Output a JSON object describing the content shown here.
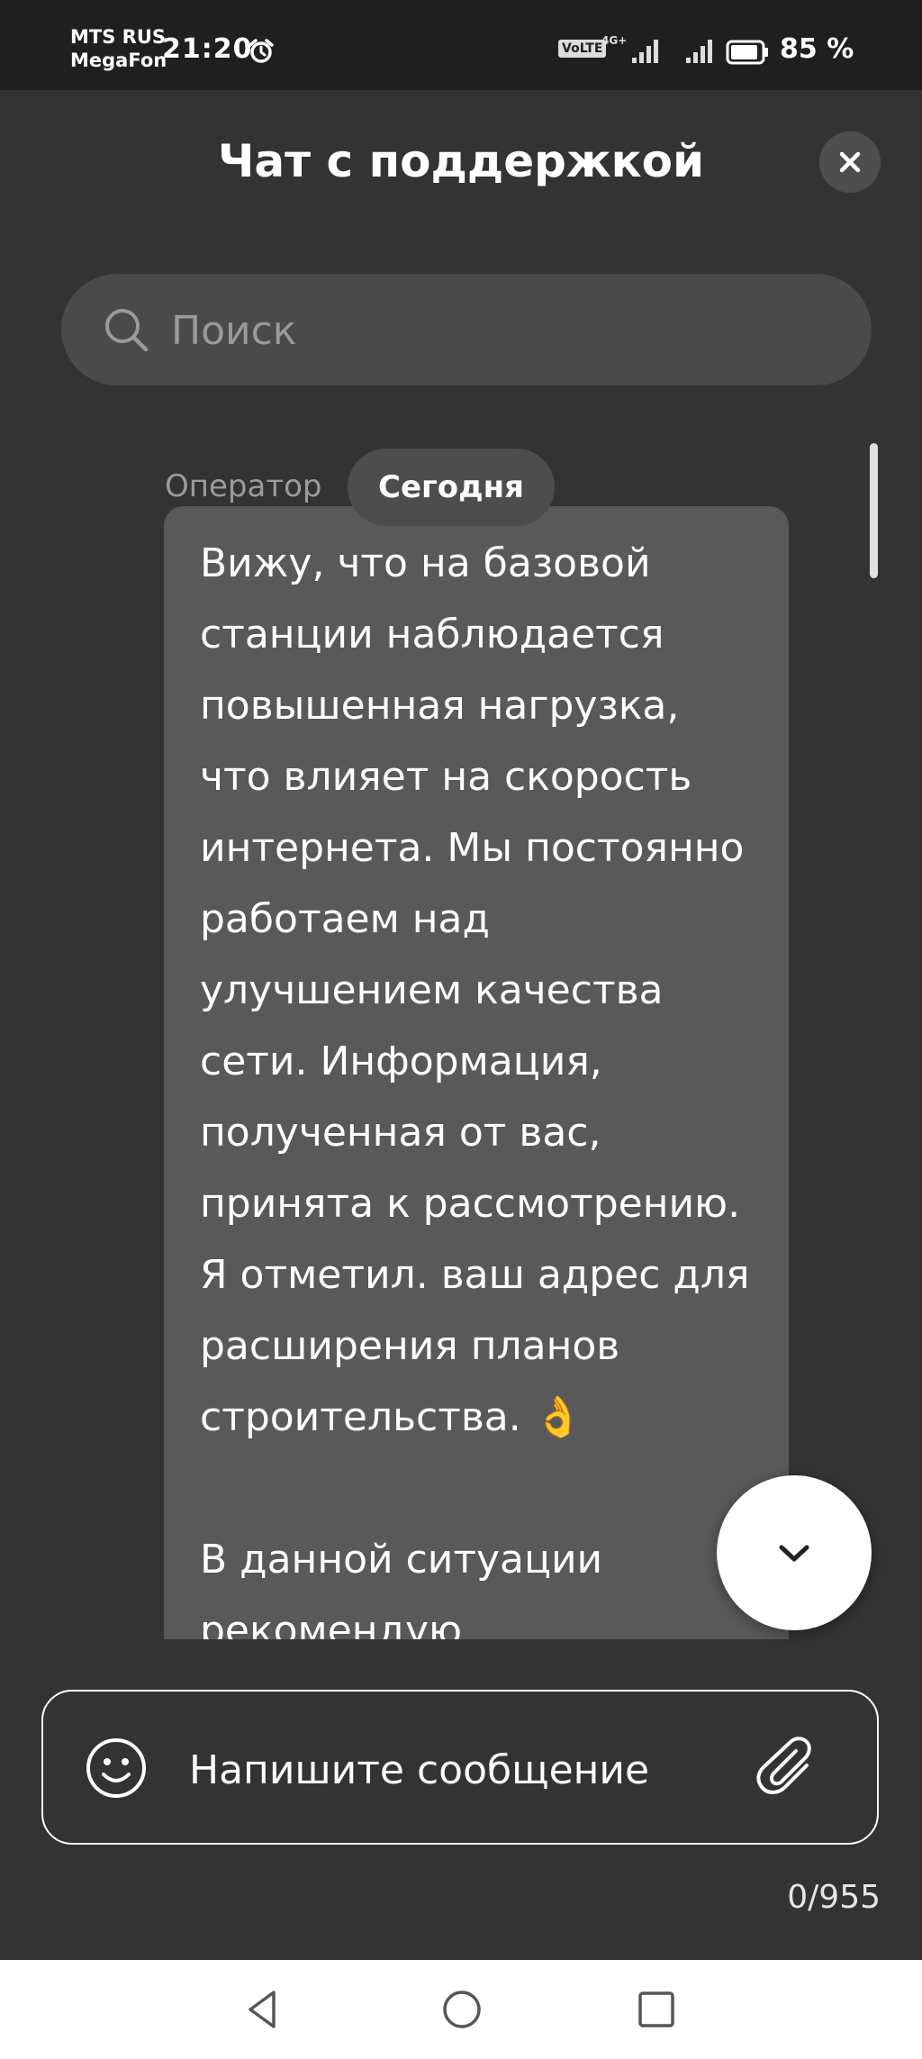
{
  "status_bar": {
    "carrier_line1": "MTS RUS",
    "carrier_line2": "MegaFon",
    "time": "21:20",
    "volte": "VoLTE",
    "network": "4G+",
    "battery": "85 %"
  },
  "header": {
    "title": "Чат с поддержкой"
  },
  "search": {
    "placeholder": "Поиск"
  },
  "chat": {
    "date_chip": "Сегодня",
    "message": {
      "sender": "Оператор",
      "text": "Вижу, что на базовой\nстанции наблюдается\nповышенная нагрузка,\nчто влияет на скорость\nинтернета. Мы постоянно\nработаем над\nулучшением качества\nсети. Информация,\nполученная от вас,\nпринята к рассмотрению.\nЯ отметил. ваш адрес для\nрасширения планов\nстроительства. 👌\n\nВ данной ситуации\nрекомендую"
    }
  },
  "composer": {
    "placeholder": "Напишите сообщение",
    "counter": "0/955"
  },
  "icons": {
    "alarm": "alarm-icon",
    "close": "close-icon",
    "search": "search-icon",
    "scroll_down": "chevron-down-icon",
    "emoji": "smiley-icon",
    "attach": "paperclip-icon",
    "nav_back": "triangle-back-icon",
    "nav_home": "circle-home-icon",
    "nav_recent": "square-recent-icon"
  },
  "colors": {
    "background": "#333333",
    "status_bar": "#1f1f1f",
    "bubble": "#595959",
    "search_bg": "#4a4a4a",
    "chip_bg": "#4d4d4d"
  }
}
